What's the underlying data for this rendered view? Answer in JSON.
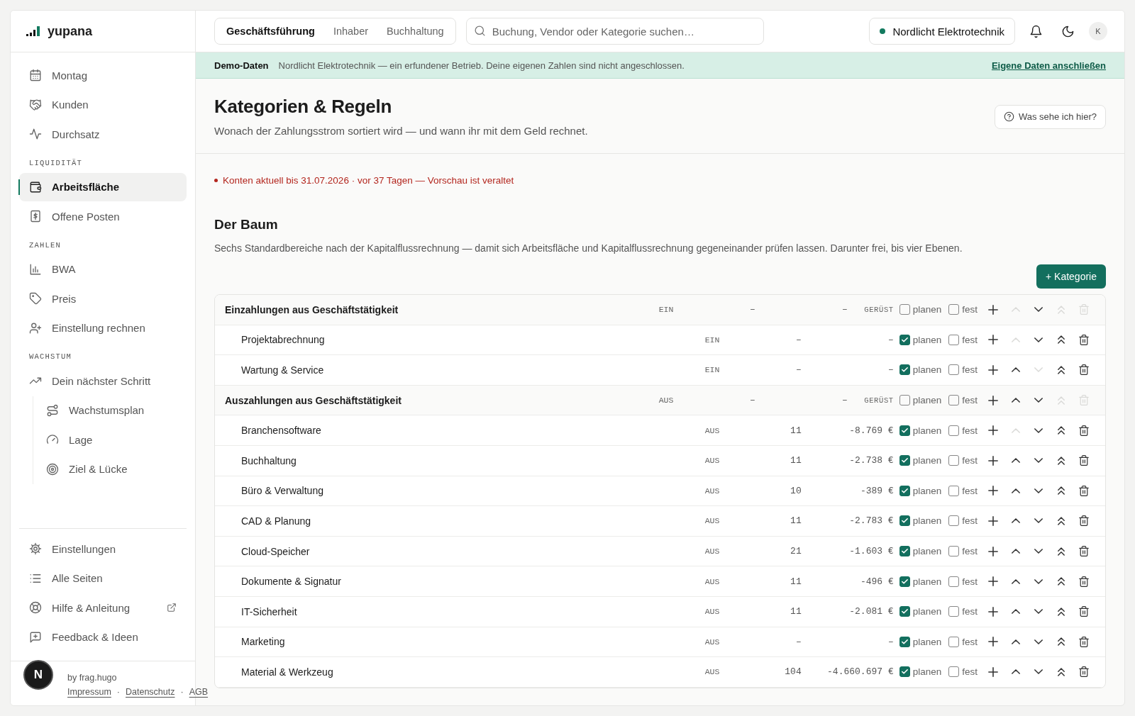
{
  "brand": {
    "name": "yupana"
  },
  "sidebar": {
    "top_items": [
      {
        "label": "Montag",
        "selected": false
      },
      {
        "label": "Kunden",
        "selected": false
      },
      {
        "label": "Durchsatz",
        "selected": false
      }
    ],
    "sections": [
      {
        "heading": "LIQUIDITÄT",
        "items": [
          {
            "label": "Arbeitsfläche",
            "selected": true
          },
          {
            "label": "Offene Posten",
            "selected": false
          }
        ]
      },
      {
        "heading": "ZAHLEN",
        "items": [
          {
            "label": "BWA",
            "selected": false
          },
          {
            "label": "Preis",
            "selected": false
          },
          {
            "label": "Einstellung rechnen",
            "selected": false
          }
        ]
      },
      {
        "heading": "WACHSTUM",
        "items": [
          {
            "label": "Dein nächster Schritt",
            "selected": false,
            "children": [
              {
                "label": "Wachstumsplan",
                "selected": false
              },
              {
                "label": "Lage",
                "selected": false
              },
              {
                "label": "Ziel & Lücke",
                "selected": false
              }
            ]
          }
        ]
      }
    ],
    "bottom_items": [
      {
        "label": "Einstellungen",
        "selected": false,
        "external": false
      },
      {
        "label": "Alle Seiten",
        "selected": false,
        "external": false
      },
      {
        "label": "Hilfe & Anleitung",
        "selected": false,
        "external": true
      },
      {
        "label": "Feedback & Ideen",
        "selected": false,
        "external": false
      }
    ],
    "footer": {
      "credit": "by frag.hugo",
      "links": [
        "Impressum",
        "Datenschutz",
        "AGB"
      ],
      "separators": [
        "·",
        "·"
      ]
    }
  },
  "dev_badge": "N",
  "topbar": {
    "tabs": [
      {
        "label": "Geschäftsführung",
        "selected": true
      },
      {
        "label": "Inhaber",
        "selected": false
      },
      {
        "label": "Buchhaltung",
        "selected": false
      }
    ],
    "search": {
      "placeholder": "Buchung, Vendor oder Kategorie suchen…"
    },
    "company": {
      "name": "Nordlicht Elektrotechnik",
      "color": "#137a5f"
    },
    "avatar": "K"
  },
  "banner": {
    "label": "Demo-Daten",
    "text": "Nordlicht Elektrotechnik — ein erfundener Betrieb. Deine eigenen Zahlen sind nicht angeschlossen.",
    "link": "Eigene Daten anschließen"
  },
  "header": {
    "title": "Kategorien & Regeln",
    "subtitle": "Wonach der Zahlungsstrom sortiert wird — und wann ihr mit dem Geld rechnet.",
    "help_button": "Was sehe ich hier?"
  },
  "alert": "Konten aktuell bis 31.07.2026 · vor 37 Tagen — Vorschau ist veraltet",
  "tree": {
    "title": "Der Baum",
    "description": "Sechs Standardbereiche nach der Kapitalflussrechnung — damit sich Arbeitsfläche und Kapitalflussrechnung gegeneinander prüfen lassen. Darunter frei, bis vier Ebenen.",
    "add_button": "+ Kategorie",
    "rows": [
      {
        "kind": "section",
        "name": "Einzahlungen aus Geschäftstätigkeit",
        "direction": "EIN",
        "count": "–",
        "amount": "–",
        "tag": "GERÜST",
        "plan": false,
        "plan_label": "planen",
        "fixed": false,
        "fixed_label": "fest",
        "up_disabled": true,
        "down_disabled": false,
        "top_disabled": true,
        "delete_disabled": true
      },
      {
        "kind": "category",
        "name": "Projektabrechnung",
        "direction": "EIN",
        "count": "–",
        "amount": "–",
        "plan": true,
        "plan_label": "planen",
        "fixed": false,
        "fixed_label": "fest",
        "up_disabled": true,
        "down_disabled": false,
        "top_disabled": false,
        "delete_disabled": false
      },
      {
        "kind": "category",
        "name": "Wartung & Service",
        "direction": "EIN",
        "count": "–",
        "amount": "–",
        "plan": true,
        "plan_label": "planen",
        "fixed": false,
        "fixed_label": "fest",
        "up_disabled": false,
        "down_disabled": true,
        "top_disabled": false,
        "delete_disabled": false
      },
      {
        "kind": "section",
        "name": "Auszahlungen aus Geschäftstätigkeit",
        "direction": "AUS",
        "count": "–",
        "amount": "–",
        "tag": "GERÜST",
        "plan": false,
        "plan_label": "planen",
        "fixed": false,
        "fixed_label": "fest",
        "up_disabled": false,
        "down_disabled": false,
        "top_disabled": true,
        "delete_disabled": true
      },
      {
        "kind": "category",
        "name": "Branchensoftware",
        "direction": "AUS",
        "count": "11",
        "amount": "-8.769 €",
        "plan": true,
        "plan_label": "planen",
        "fixed": false,
        "fixed_label": "fest",
        "up_disabled": true,
        "down_disabled": false,
        "top_disabled": false,
        "delete_disabled": false
      },
      {
        "kind": "category",
        "name": "Buchhaltung",
        "direction": "AUS",
        "count": "11",
        "amount": "-2.738 €",
        "plan": true,
        "plan_label": "planen",
        "fixed": false,
        "fixed_label": "fest",
        "up_disabled": false,
        "down_disabled": false,
        "top_disabled": false,
        "delete_disabled": false
      },
      {
        "kind": "category",
        "name": "Büro & Verwaltung",
        "direction": "AUS",
        "count": "10",
        "amount": "-389 €",
        "plan": true,
        "plan_label": "planen",
        "fixed": false,
        "fixed_label": "fest",
        "up_disabled": false,
        "down_disabled": false,
        "top_disabled": false,
        "delete_disabled": false
      },
      {
        "kind": "category",
        "name": "CAD & Planung",
        "direction": "AUS",
        "count": "11",
        "amount": "-2.783 €",
        "plan": true,
        "plan_label": "planen",
        "fixed": false,
        "fixed_label": "fest",
        "up_disabled": false,
        "down_disabled": false,
        "top_disabled": false,
        "delete_disabled": false
      },
      {
        "kind": "category",
        "name": "Cloud-Speicher",
        "direction": "AUS",
        "count": "21",
        "amount": "-1.603 €",
        "plan": true,
        "plan_label": "planen",
        "fixed": false,
        "fixed_label": "fest",
        "up_disabled": false,
        "down_disabled": false,
        "top_disabled": false,
        "delete_disabled": false
      },
      {
        "kind": "category",
        "name": "Dokumente & Signatur",
        "direction": "AUS",
        "count": "11",
        "amount": "-496 €",
        "plan": true,
        "plan_label": "planen",
        "fixed": false,
        "fixed_label": "fest",
        "up_disabled": false,
        "down_disabled": false,
        "top_disabled": false,
        "delete_disabled": false
      },
      {
        "kind": "category",
        "name": "IT-Sicherheit",
        "direction": "AUS",
        "count": "11",
        "amount": "-2.081 €",
        "plan": true,
        "plan_label": "planen",
        "fixed": false,
        "fixed_label": "fest",
        "up_disabled": false,
        "down_disabled": false,
        "top_disabled": false,
        "delete_disabled": false
      },
      {
        "kind": "category",
        "name": "Marketing",
        "direction": "AUS",
        "count": "–",
        "amount": "–",
        "plan": true,
        "plan_label": "planen",
        "fixed": false,
        "fixed_label": "fest",
        "up_disabled": false,
        "down_disabled": false,
        "top_disabled": false,
        "delete_disabled": false
      },
      {
        "kind": "category",
        "name": "Material & Werkzeug",
        "direction": "AUS",
        "count": "104",
        "amount": "-4.660.697 €",
        "plan": true,
        "plan_label": "planen",
        "fixed": false,
        "fixed_label": "fest",
        "up_disabled": false,
        "down_disabled": false,
        "top_disabled": false,
        "delete_disabled": false
      }
    ]
  }
}
